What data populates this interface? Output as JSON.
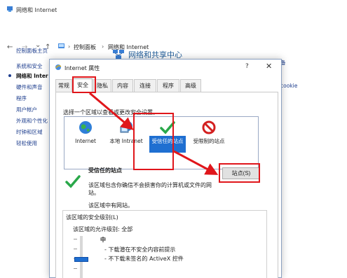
{
  "window": {
    "title": "网络和 Internet",
    "breadcrumb": [
      "控制面板",
      "网络和 Internet"
    ],
    "nav": {
      "back": "←",
      "forward": "→",
      "dropdown": "⌄",
      "up": "↑",
      "separator": "›"
    }
  },
  "sidebar": {
    "items": [
      {
        "label": "控制面板主页"
      },
      {
        "label": "系统和安全"
      },
      {
        "label": "网络和 Inter"
      },
      {
        "label": "硬件和声音"
      },
      {
        "label": "程序"
      },
      {
        "label": "用户帐户"
      },
      {
        "label": "外观和个性化"
      },
      {
        "label": "时钟和区域"
      },
      {
        "label": "轻松使用"
      }
    ],
    "current_index": 2
  },
  "main": {
    "title": "网络和共享中心",
    "right_fragment_1": "备",
    "right_fragment_2": "cookie"
  },
  "dialog": {
    "title": "Internet 属性",
    "help": "?",
    "close": "✕",
    "tabs": [
      {
        "label": "常规"
      },
      {
        "label": "安全"
      },
      {
        "label": "隐私"
      },
      {
        "label": "内容"
      },
      {
        "label": "连接"
      },
      {
        "label": "程序"
      },
      {
        "label": "高级"
      }
    ],
    "active_tab": "安全",
    "zone_prompt": "选择一个区域以查看或更改安全设置。",
    "zones": [
      {
        "label": "Internet",
        "icon": "globe-icon"
      },
      {
        "label": "本地 Intranet",
        "icon": "intranet-icon"
      },
      {
        "label": "受信任的站点",
        "icon": "checkmark-icon"
      },
      {
        "label": "受限制的站点",
        "icon": "restricted-icon"
      }
    ],
    "selected_zone": "受信任的站点",
    "sites_button": "站点(S)",
    "zone_detail": {
      "name": "受信任的站点",
      "description": "该区域包含你确信不会损害你的计算机或文件的网站。",
      "no_sites": "该区域中有网站。"
    },
    "security_level": {
      "group_title": "该区域的安全级别(L)",
      "allowed_levels": "该区域的允许级别: 全部",
      "level_name": "中",
      "bullets": [
        "- 下载潜在不安全内容前提示",
        "- 不下载未签名的 ActiveX 控件"
      ]
    }
  },
  "colors": {
    "accent": "#1f6fd1",
    "annotation": "#e0161b",
    "check_green": "#2aa84a",
    "restricted_red": "#d32020",
    "link": "#1e3e8e"
  }
}
